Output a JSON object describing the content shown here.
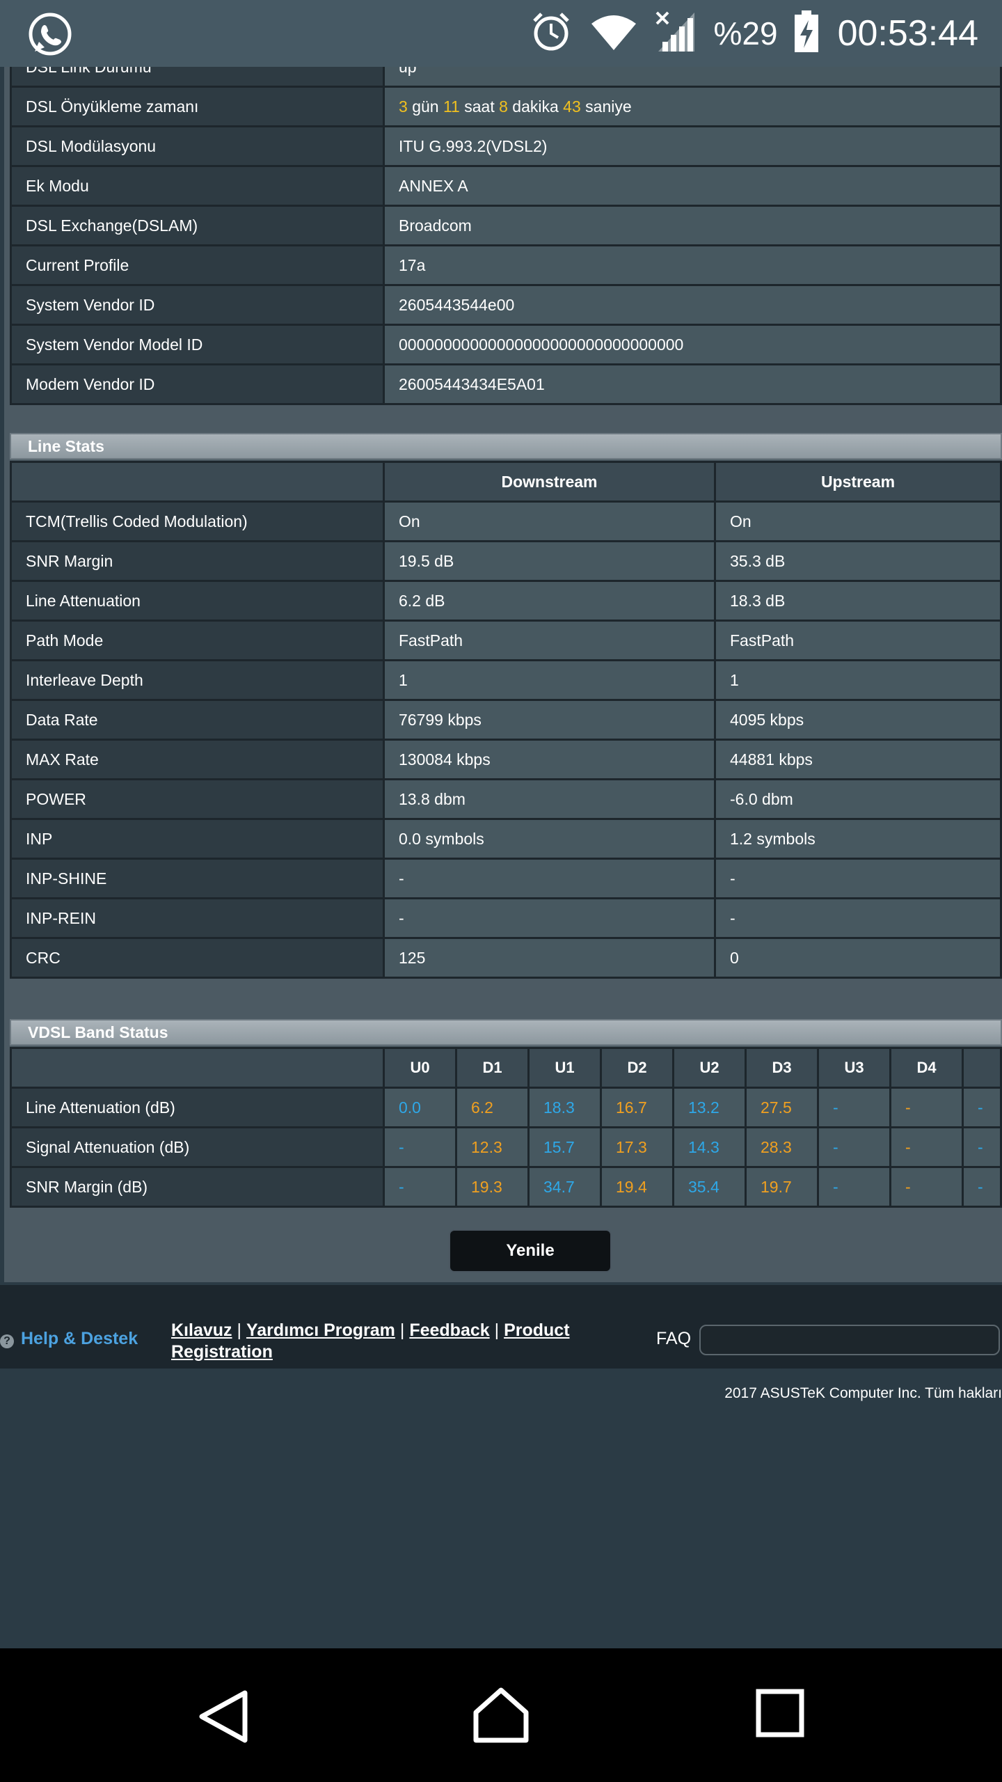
{
  "status_bar": {
    "battery_percent": "%29",
    "time": "00:53:44",
    "icons": [
      "whatsapp-icon",
      "alarm-icon",
      "wifi-icon",
      "signal-icon",
      "battery-charging-icon"
    ]
  },
  "dsl_info": {
    "cut_off_label": "DSL Link Durumu",
    "cut_off_value": "up",
    "uptime": {
      "label": "DSL Önyükleme zamanı",
      "days": "3",
      "days_unit": "gün",
      "hours": "11",
      "hours_unit": "saat",
      "minutes": "8",
      "minutes_unit": "dakika",
      "seconds": "43",
      "seconds_unit": "saniye"
    },
    "rows": [
      {
        "label": "DSL Modülasyonu",
        "value": "ITU G.993.2(VDSL2)"
      },
      {
        "label": "Ek Modu",
        "value": "ANNEX A"
      },
      {
        "label": "DSL Exchange(DSLAM)",
        "value": "Broadcom"
      },
      {
        "label": "Current Profile",
        "value": "17a"
      },
      {
        "label": "System Vendor ID",
        "value": "2605443544e00"
      },
      {
        "label": "System Vendor Model ID",
        "value": "00000000000000000000000000000000"
      },
      {
        "label": "Modem Vendor ID",
        "value": "26005443434E5A01"
      }
    ]
  },
  "line_stats": {
    "title": "Line Stats",
    "col_downstream": "Downstream",
    "col_upstream": "Upstream",
    "rows": [
      {
        "label": "TCM(Trellis Coded Modulation)",
        "down": "On",
        "up": "On"
      },
      {
        "label": "SNR Margin",
        "down": "19.5 dB",
        "up": "35.3 dB"
      },
      {
        "label": "Line Attenuation",
        "down": "6.2 dB",
        "up": "18.3 dB"
      },
      {
        "label": "Path Mode",
        "down": "FastPath",
        "up": "FastPath"
      },
      {
        "label": "Interleave Depth",
        "down": "1",
        "up": "1"
      },
      {
        "label": "Data Rate",
        "down": "76799 kbps",
        "up": "4095 kbps"
      },
      {
        "label": "MAX Rate",
        "down": "130084 kbps",
        "up": "44881 kbps"
      },
      {
        "label": "POWER",
        "down": "13.8 dbm",
        "up": "-6.0 dbm"
      },
      {
        "label": "INP",
        "down": "0.0 symbols",
        "up": "1.2 symbols"
      },
      {
        "label": "INP-SHINE",
        "down": "-",
        "up": "-"
      },
      {
        "label": "INP-REIN",
        "down": "-",
        "up": "-"
      },
      {
        "label": "CRC",
        "down": "125",
        "up": "0"
      }
    ]
  },
  "vdsl_band": {
    "title": "VDSL Band Status",
    "bands": [
      "U0",
      "D1",
      "U1",
      "D2",
      "U2",
      "D3",
      "U3",
      "D4"
    ],
    "rows": [
      {
        "label": "Line Attenuation (dB)",
        "values": [
          "0.0",
          "6.2",
          "18.3",
          "16.7",
          "13.2",
          "27.5",
          "-",
          "-",
          "-"
        ]
      },
      {
        "label": "Signal Attenuation (dB)",
        "values": [
          "-",
          "12.3",
          "15.7",
          "17.3",
          "14.3",
          "28.3",
          "-",
          "-",
          "-"
        ]
      },
      {
        "label": "SNR Margin (dB)",
        "values": [
          "-",
          "19.3",
          "34.7",
          "19.4",
          "35.4",
          "19.7",
          "-",
          "-",
          "-"
        ]
      }
    ],
    "colors": {
      "upstream": "#2ea8e8",
      "downstream": "#f0a020"
    }
  },
  "refresh_button": "Yenile",
  "footer": {
    "help": "Help & Destek",
    "links": [
      "Kılavuz",
      "Yardımcı Program",
      "Feedback",
      "Product Registration"
    ],
    "separator": "|",
    "faq": "FAQ",
    "copyright": "2017 ASUSTeK Computer Inc. Tüm hakları"
  }
}
